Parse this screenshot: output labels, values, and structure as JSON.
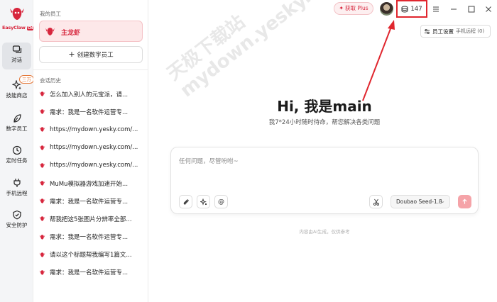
{
  "app": {
    "name": "EasyClaw",
    "name_tag": "CN"
  },
  "rail": {
    "items": [
      {
        "label": "对话",
        "icon": "chat-icon"
      },
      {
        "label": "技能商店",
        "icon": "sparkle-icon",
        "badge": "三万"
      },
      {
        "label": "数字员工",
        "icon": "leaf-icon"
      },
      {
        "label": "定时任务",
        "icon": "clock-icon"
      },
      {
        "label": "手机远程",
        "icon": "plug-icon"
      },
      {
        "label": "安全防护",
        "icon": "shield-icon"
      }
    ]
  },
  "sidebar": {
    "employees_title": "我的员工",
    "employee_name": "主龙虾",
    "create_label": "创建数字员工",
    "history_title": "会话历史",
    "history": [
      "怎么加入别人的元宝派，请...",
      "需求：我是一名软件运营专...",
      "https://mydown.yesky.com/...",
      "https://mydown.yesky.com/...",
      "https://mydown.yesky.com/...",
      "MuMu模拟器游戏加速开始...",
      "需求：我是一名软件运营专...",
      "帮我把这5张图片分辨率全部...",
      "需求：我是一名软件运营专...",
      "请以这个标题帮我编写1篇文...",
      "需求：我是一名软件运营专..."
    ]
  },
  "topbar": {
    "plus_label": "获取 Plus",
    "credits": "147",
    "settings_label": "员工设置",
    "settings_sub": "手机远程 (0)"
  },
  "main": {
    "title": "Hi, 我是main",
    "subtitle": "我7*24小时随时待命，帮您解决各类问题",
    "input_placeholder": "任何问题，尽管吩咐~",
    "mention_symbol": "@",
    "model": "Doubao Seed-1.8",
    "disclaimer": "内容由AI生成，仅供参考"
  },
  "watermark": {
    "line1": "天极下载站",
    "line2": "mydown.yesky.com"
  },
  "colors": {
    "accent": "#d7263d",
    "callout": "#e0262e"
  }
}
